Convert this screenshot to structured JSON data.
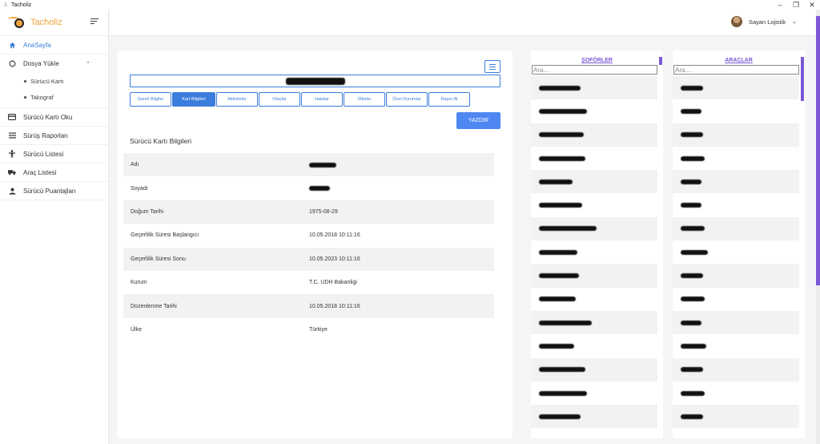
{
  "window": {
    "title": "Tacholiz",
    "controls": [
      "minimize-icon",
      "restore-icon",
      "close-icon"
    ]
  },
  "sidebar": {
    "logo_text": "Tacholiz",
    "items": [
      {
        "label": "AnaSayfa",
        "icon": "home-icon",
        "active": true
      },
      {
        "label": "Dosya Yükle",
        "icon": "circle-icon",
        "expanded": true,
        "children": [
          {
            "label": "Sürücü Kartı"
          },
          {
            "label": "Takograf"
          }
        ]
      },
      {
        "label": "Sürücü Kartı Oku",
        "icon": "card-icon"
      },
      {
        "label": "Sürüş Raporları",
        "icon": "list-icon"
      },
      {
        "label": "Sürücü Listesi",
        "icon": "person-arms-icon"
      },
      {
        "label": "Araç Listesi",
        "icon": "truck-icon"
      },
      {
        "label": "Sürücü Puantajları",
        "icon": "user-icon"
      }
    ]
  },
  "header": {
    "user_name": "Sayan Lojistik"
  },
  "main": {
    "tabs": [
      {
        "label": "Genel Bilgiler",
        "active": false
      },
      {
        "label": "Kart Bilgileri",
        "active": true
      },
      {
        "label": "Aktiviteler",
        "active": false
      },
      {
        "label": "Olaylar",
        "active": false
      },
      {
        "label": "Hatalar",
        "active": false
      },
      {
        "label": "Ülkeler",
        "active": false
      },
      {
        "label": "Özel Durumlar",
        "active": false
      },
      {
        "label": "Rapor Al",
        "active": false
      }
    ],
    "print_label": "YAZDIR",
    "section_title": "Sürücü Kartı Bilgileri",
    "rows": [
      {
        "label": "Adı",
        "value": "",
        "redacted": true
      },
      {
        "label": "Soyadı",
        "value": "",
        "redacted": true
      },
      {
        "label": "Doğum Tarihi",
        "value": "1975-08-29"
      },
      {
        "label": "Geçerlilik Süresi Başlangıcı",
        "value": "10.05.2018 10:11:16"
      },
      {
        "label": "Geçerlilik Süresi Sonu",
        "value": "10.05.2023 10:11:16"
      },
      {
        "label": "Kurum",
        "value": "T.C. UDH Bakanligi"
      },
      {
        "label": "Düzenlenme Tarihi",
        "value": "10.05.2018 10:11:16"
      },
      {
        "label": "Ülke",
        "value": "Türkiye"
      }
    ]
  },
  "drivers": {
    "title": "ŞOFÖRLER",
    "search_placeholder": "Ara....",
    "row_count": 15
  },
  "vehicles": {
    "title": "ARAÇLAR",
    "search_placeholder": "Ara....",
    "row_count": 15
  },
  "colors": {
    "primary": "#3b7ddd",
    "print_button": "#4f87f2",
    "accent_purple": "#7b57d6",
    "logo_orange": "#f0a33a"
  }
}
